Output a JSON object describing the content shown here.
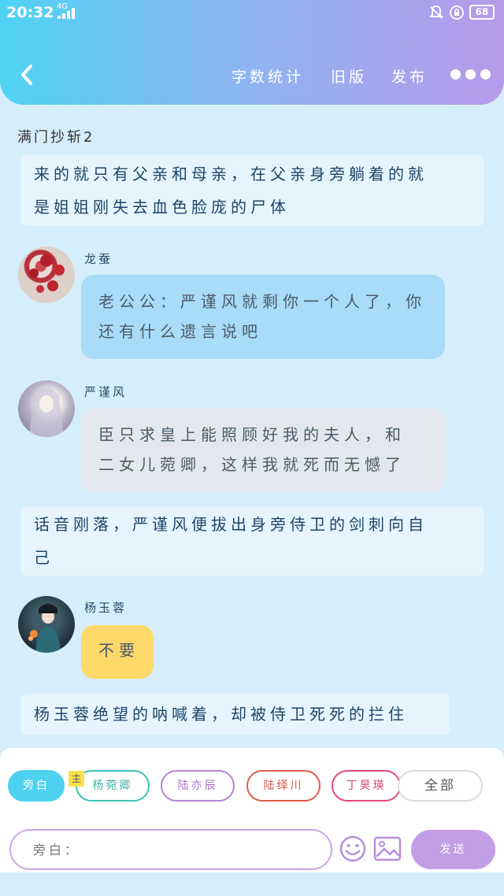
{
  "status_bar": {
    "time": "20:32",
    "network": "4G",
    "battery": "68"
  },
  "header": {
    "word_count": "字数统计",
    "old_version": "旧版",
    "publish": "发布"
  },
  "doc_title": "满门抄斩2",
  "messages": {
    "narr1": {
      "line1": "来的就只有父亲和母亲，在父亲身旁躺着的就",
      "line2": "是姐姐刚失去血色脸庞的尸体"
    },
    "m1": {
      "name": "龙蚕",
      "line1": "老公公：严谨风就剩你一个人了，你",
      "line2": "还有什么遗言说吧"
    },
    "m2": {
      "name": "严谨风",
      "line1": "臣只求皇上能照顾好我的夫人，和",
      "line2": "二女儿菀卿，这样我就死而无憾了"
    },
    "narr2": {
      "line1": "话音刚落，严谨风便拔出身旁侍卫的剑刺向自",
      "line2": "己"
    },
    "m3": {
      "name": "杨玉蓉",
      "text": "不要"
    },
    "narr3": {
      "text": "杨玉蓉绝望的呐喊着，却被侍卫死死的拦住"
    }
  },
  "roles": {
    "narrator": "旁白",
    "main_badge": "主",
    "r1": "杨菀卿",
    "r2": "陆亦辰",
    "r3": "陆绎川",
    "r4": "丁昊瑛",
    "all": "全部"
  },
  "input": {
    "placeholder": "旁白："
  },
  "send_label": "发送",
  "colors": {
    "accent_purple": "#c29ee6",
    "bubble_blue": "#a9dcf9",
    "bubble_gray": "#e4e8ee",
    "bubble_yellow": "#fdd96a",
    "chip_blue": "#4fd2f2"
  }
}
